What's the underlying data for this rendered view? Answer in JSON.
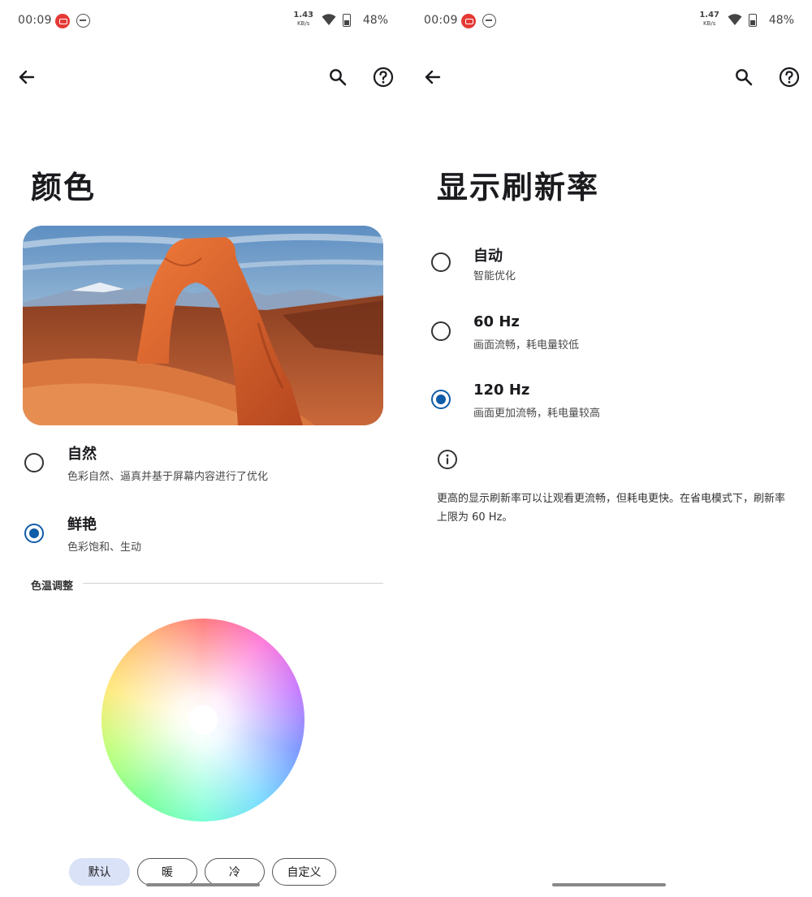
{
  "colors": {
    "accent": "#0f5ca8",
    "chip_selected_bg": "#d9e2f6",
    "status_badge": "#e53935"
  },
  "left": {
    "status": {
      "time": "00:09",
      "speed_value": "1.43",
      "speed_unit": "KB/s",
      "battery": "48%"
    },
    "toolbar": {
      "back_icon": "arrow-back-icon",
      "search_icon": "search-icon",
      "help_icon": "help-icon"
    },
    "title": "颜色",
    "hero_image": "sandstone-arch-landscape",
    "modes": [
      {
        "title": "自然",
        "subtitle": "色彩自然、逼真并基于屏幕内容进行了优化",
        "selected": false
      },
      {
        "title": "鲜艳",
        "subtitle": "色彩饱和、生动",
        "selected": true
      }
    ],
    "section": {
      "label": "色温调整"
    },
    "presets": [
      {
        "label": "默认",
        "selected": true
      },
      {
        "label": "暖",
        "selected": false
      },
      {
        "label": "冷",
        "selected": false
      },
      {
        "label": "自定义",
        "selected": false
      }
    ]
  },
  "right": {
    "status": {
      "time": "00:09",
      "speed_value": "1.47",
      "speed_unit": "KB/s",
      "battery": "48%"
    },
    "toolbar": {
      "back_icon": "arrow-back-icon",
      "search_icon": "search-icon",
      "help_icon": "help-icon"
    },
    "title": "显示刷新率",
    "options": [
      {
        "title": "自动",
        "subtitle": "智能优化",
        "selected": false
      },
      {
        "title": "60 Hz",
        "subtitle": "画面流畅，耗电量较低",
        "selected": false
      },
      {
        "title": "120 Hz",
        "subtitle": "画面更加流畅，耗电量较高",
        "selected": true
      }
    ],
    "info": {
      "icon": "info-icon",
      "text": "更高的显示刷新率可以让观看更流畅，但耗电更快。在省电模式下，刷新率上限为 60 Hz。"
    }
  }
}
